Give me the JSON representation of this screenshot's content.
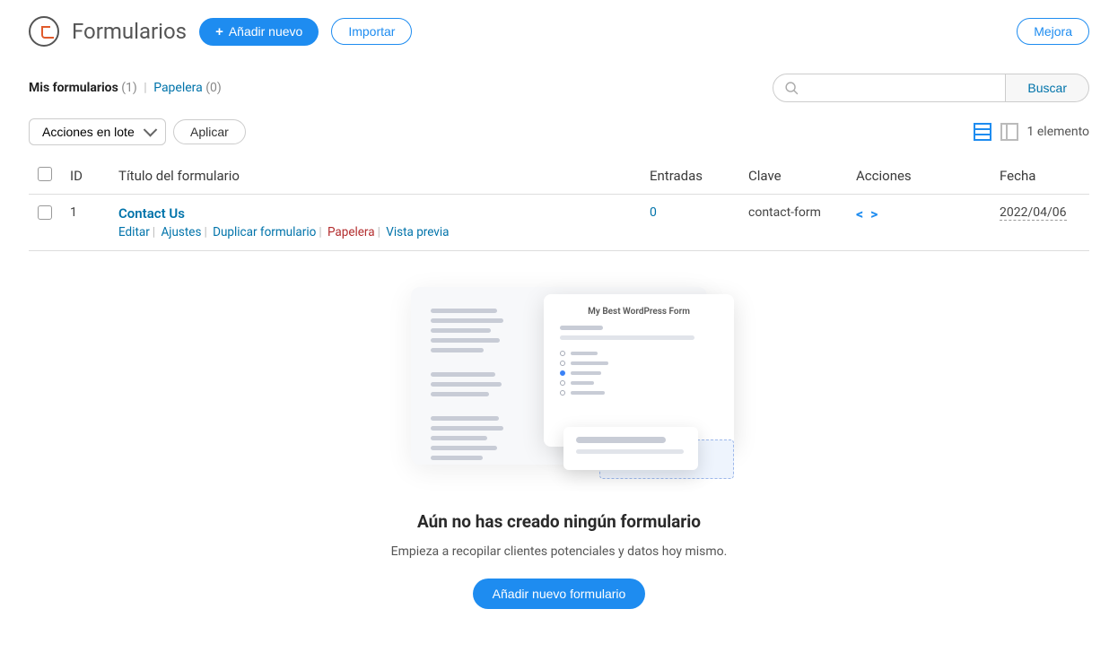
{
  "header": {
    "title": "Formularios",
    "add_new": "Añadir nuevo",
    "import": "Importar",
    "upgrade": "Mejora"
  },
  "subnav": {
    "my_forms": "Mis formularios",
    "my_forms_count": "(1)",
    "trash": "Papelera",
    "trash_count": "(0)"
  },
  "search": {
    "button": "Buscar"
  },
  "toolbar": {
    "bulk_placeholder": "Acciones en lote",
    "apply": "Aplicar",
    "count_label": "1 elemento"
  },
  "table": {
    "headers": {
      "id": "ID",
      "title": "Título del formulario",
      "entries": "Entradas",
      "key": "Clave",
      "actions": "Acciones",
      "date": "Fecha"
    },
    "row": {
      "id": "1",
      "title": "Contact Us",
      "entries": "0",
      "key": "contact-form",
      "date": "2022/04/06",
      "actions": {
        "edit": "Editar",
        "settings": "Ajustes",
        "duplicate": "Duplicar formulario",
        "trash": "Papelera",
        "preview": "Vista previa"
      }
    }
  },
  "empty_state": {
    "illustration_title": "My Best WordPress Form",
    "title": "Aún no has creado ningún formulario",
    "subtitle": "Empieza a recopilar clientes potenciales y datos hoy mismo.",
    "button": "Añadir nuevo formulario"
  }
}
